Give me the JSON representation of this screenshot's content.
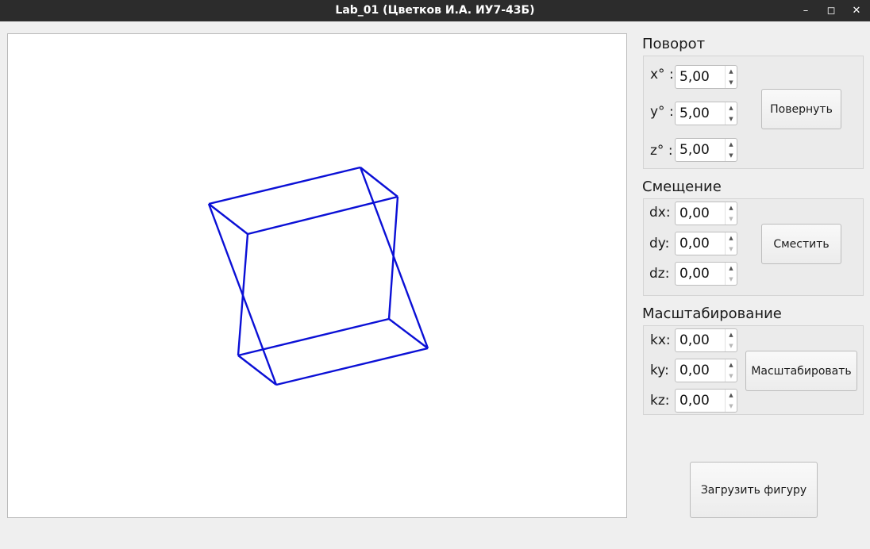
{
  "window": {
    "title": "Lab_01 (Цветков И.А. ИУ7-43Б)",
    "minimize_icon": "minimize-icon",
    "maximize_icon": "maximize-icon",
    "close_icon": "close-icon"
  },
  "figure": {
    "color": "#0b10d6",
    "shape": "cube wireframe"
  },
  "rotation": {
    "title": "Поворот",
    "x_label": "x° :",
    "y_label": "y° :",
    "z_label": "z° :",
    "x_value": "5,00",
    "y_value": "5,00",
    "z_value": "5,00",
    "button_label": "Повернуть"
  },
  "translation": {
    "title": "Смещение",
    "dx_label": "dx:",
    "dy_label": "dy:",
    "dz_label": "dz:",
    "dx_value": "0,00",
    "dy_value": "0,00",
    "dz_value": "0,00",
    "button_label": "Сместить"
  },
  "scaling": {
    "title": "Масштабирование",
    "kx_label": "kx:",
    "ky_label": "ky:",
    "kz_label": "kz:",
    "kx_value": "0,00",
    "ky_value": "0,00",
    "kz_value": "0,00",
    "button_label": "Масштабировать"
  },
  "load_button_label": "Загрузить фигуру",
  "spin_up_glyph": "▲",
  "spin_down_glyph": "▼"
}
